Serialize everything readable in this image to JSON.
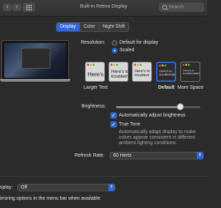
{
  "window": {
    "title": "Built-in Retina Display"
  },
  "toolbar": {
    "back": "‹",
    "forward": "›",
    "search_placeholder": "Search"
  },
  "tabs": [
    {
      "label": "Display",
      "active": true
    },
    {
      "label": "Color",
      "active": false
    },
    {
      "label": "Night Shift",
      "active": false
    }
  ],
  "resolution": {
    "label": "Resolution:",
    "options": [
      {
        "label": "Default for display",
        "selected": false
      },
      {
        "label": "Scaled",
        "selected": true
      }
    ]
  },
  "scaled_options": {
    "thumbs": [
      {
        "text": "Here's",
        "selected": false
      },
      {
        "text": "Here's to troublem",
        "selected": false
      },
      {
        "text": "Here's to troublem",
        "selected": false
      },
      {
        "text": "Here's to troublemakers",
        "selected": true
      },
      {
        "text": "Here's to troublemakers",
        "selected": false
      }
    ],
    "captions": {
      "left": "Larger Text",
      "default": "Default",
      "right": "More Space"
    }
  },
  "brightness": {
    "label": "Brightness:",
    "level": 0.76,
    "auto_label": "Automatically adjust brightness",
    "auto_checked": true
  },
  "true_tone": {
    "label": "True Tone",
    "checked": true,
    "description": "Automatically adapt display to make colors appear consistent in different ambient lighting conditions."
  },
  "refresh_rate": {
    "label": "Refresh Rate:",
    "value": "60 Hertz"
  },
  "airplay": {
    "label": "splay:",
    "value": "Off"
  },
  "mirroring": {
    "text": "irroring options in the menu bar when available"
  },
  "colors": {
    "accent": "#2f67d6",
    "background": "#2b2b2b"
  },
  "icons": [
    "back-icon",
    "forward-icon",
    "show-all-icon",
    "search-icon",
    "laptop-icon",
    "checkmark-icon",
    "chevron-updown-icon"
  ]
}
